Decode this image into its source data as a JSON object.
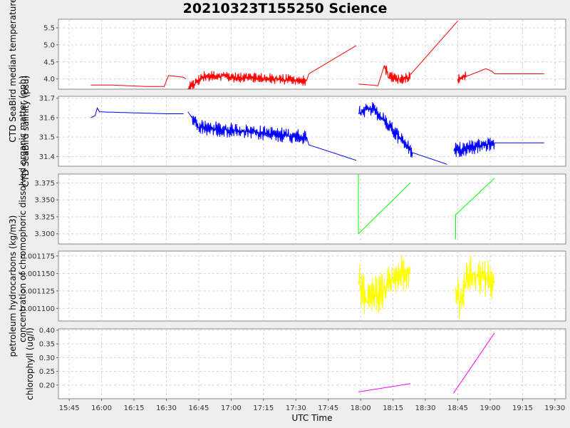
{
  "chart_data": {
    "title": "20210323T155250 Science",
    "xlabel": "UTC Time",
    "x_ticks": [
      "15:45",
      "16:00",
      "16:15",
      "16:30",
      "16:45",
      "17:00",
      "17:15",
      "17:30",
      "17:45",
      "18:00",
      "18:15",
      "18:30",
      "18:45",
      "19:00",
      "19:15",
      "19:30"
    ],
    "grid": true,
    "panels": [
      {
        "type": "line",
        "ylabel": "CTD SeaBird median temperature (degC)",
        "ylim": [
          3.7,
          5.75
        ],
        "y_ticks": [
          "4.0",
          "4.5",
          "5.0",
          "5.5"
        ],
        "color": "#ff0000",
        "noise": 0.08,
        "segments": [
          [
            [
              "15:55",
              3.82
            ],
            [
              "16:05",
              3.82
            ],
            [
              "16:20",
              3.78
            ],
            [
              "16:29",
              3.78
            ],
            [
              "16:31",
              4.1
            ],
            [
              "16:38",
              4.05
            ],
            [
              "16:39",
              4.0
            ]
          ],
          [
            [
              "16:40",
              3.72
            ],
            [
              "16:43",
              3.85
            ],
            [
              "16:47",
              4.08
            ],
            [
              "16:55",
              4.1
            ],
            [
              "17:05",
              4.02
            ],
            [
              "17:15",
              4.02
            ],
            [
              "17:25",
              3.98
            ],
            [
              "17:35",
              3.95
            ],
            [
              "17:36",
              4.15
            ],
            [
              "17:58",
              4.98
            ]
          ],
          [
            [
              "17:59",
              3.85
            ],
            [
              "18:05",
              3.82
            ],
            [
              "18:08",
              3.8
            ],
            [
              "18:11",
              4.4
            ],
            [
              "18:13",
              4.05
            ],
            [
              "18:18",
              4.0
            ],
            [
              "18:22",
              4.05
            ],
            [
              "18:45",
              5.7
            ]
          ],
          [
            [
              "18:45",
              4.0
            ],
            [
              "18:50",
              4.1
            ],
            [
              "18:58",
              4.3
            ],
            [
              "19:01",
              4.22
            ],
            [
              "19:02",
              4.15
            ],
            [
              "19:25",
              4.15
            ]
          ]
        ],
        "noisy": [
          [
            "16:40",
            "17:35"
          ],
          [
            "18:11",
            "18:23"
          ],
          [
            "18:45",
            "18:49"
          ]
        ]
      },
      {
        "type": "line",
        "ylabel": "CTD SeaBird salinity (psu)",
        "ylim": [
          31.35,
          31.71
        ],
        "y_ticks": [
          "31.4",
          "31.5",
          "31.6",
          "31.7"
        ],
        "color": "#0000ff",
        "noise": 0.11,
        "segments": [
          [
            [
              "15:55",
              31.6
            ],
            [
              "15:57",
              31.61
            ],
            [
              "15:58",
              31.65
            ],
            [
              "15:59",
              31.63
            ],
            [
              "16:30",
              31.62
            ],
            [
              "16:38",
              31.62
            ]
          ],
          [
            [
              "16:40",
              31.63
            ],
            [
              "16:45",
              31.55
            ],
            [
              "17:35",
              31.5
            ],
            [
              "17:36",
              31.46
            ],
            [
              "17:58",
              31.38
            ]
          ],
          [
            [
              "17:59",
              31.62
            ],
            [
              "18:05",
              31.65
            ],
            [
              "18:10",
              31.6
            ],
            [
              "18:24",
              31.42
            ],
            [
              "18:40",
              31.36
            ]
          ],
          [
            [
              "18:43",
              31.43
            ],
            [
              "19:02",
              31.47
            ],
            [
              "19:25",
              31.47
            ]
          ]
        ],
        "noisy": [
          [
            "16:42",
            "17:35"
          ],
          [
            "17:59",
            "18:24"
          ],
          [
            "18:43",
            "19:02"
          ]
        ]
      },
      {
        "type": "line",
        "ylabel": "concentration of chromophoric dissolved organic matter (ppb)",
        "ylim": [
          3.285,
          3.388
        ],
        "y_ticks": [
          "3.300",
          "3.325",
          "3.350",
          "3.375"
        ],
        "color": "#00ff00",
        "noise": 0,
        "segments": [
          [
            [
              "17:59",
              3.39
            ],
            [
              "17:59",
              3.3
            ],
            [
              "18:23",
              3.375
            ]
          ],
          [
            [
              "18:44",
              3.292
            ],
            [
              "18:44",
              3.328
            ],
            [
              "19:02",
              3.382
            ]
          ]
        ],
        "noisy": []
      },
      {
        "type": "line",
        "ylabel": "petroleum hydrocarbons (kg/m3)",
        "ylim": [
          1.001082,
          1.001182
        ],
        "y_ticks": [
          "1.001100",
          "1.001125",
          "1.001150",
          "1.001175"
        ],
        "tick_labels_shown": [
          "0.001100",
          "0.001125",
          "0.001150",
          "0.001175"
        ],
        "color": "#ffff00",
        "noise": 0.3,
        "segments": [
          [
            [
              "17:59",
              1.00114
            ],
            [
              "18:00",
              1.00113
            ],
            [
              "18:03",
              1.00111
            ],
            [
              "18:08",
              1.00112
            ],
            [
              "18:15",
              1.00114
            ],
            [
              "18:23",
              1.00116
            ]
          ],
          [
            [
              "18:44",
              1.00113
            ],
            [
              "18:46",
              1.00111
            ],
            [
              "18:50",
              1.00115
            ],
            [
              "19:02",
              1.00114
            ]
          ]
        ],
        "noisy": [
          [
            "17:59",
            "18:23"
          ],
          [
            "18:44",
            "19:02"
          ]
        ]
      },
      {
        "type": "line",
        "ylabel": "chlorophyll (ug/l)",
        "ylim": [
          0.15,
          0.405
        ],
        "y_ticks": [
          "0.20",
          "0.25",
          "0.30",
          "0.35",
          "0.40"
        ],
        "color": "#ff00ff",
        "noise": 0,
        "segments": [
          [
            [
              "17:59",
              0.175
            ],
            [
              "18:23",
              0.205
            ]
          ],
          [
            [
              "18:43",
              0.17
            ],
            [
              "19:02",
              0.39
            ]
          ]
        ],
        "noisy": []
      }
    ]
  }
}
